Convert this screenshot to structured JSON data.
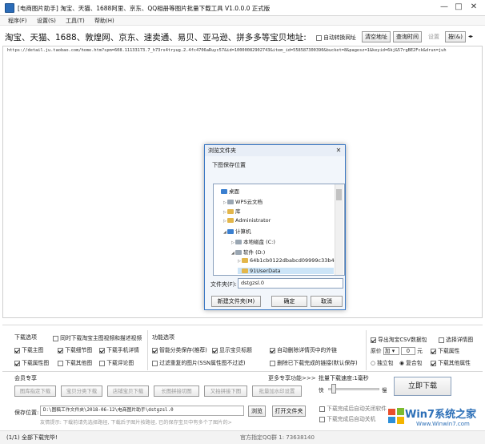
{
  "app": {
    "title": "[电商图片助手] 淘宝、天猫、1688阿里、京东、QQ相册等图片批量下载工具 V1.0.0.0 正式版",
    "window_controls": [
      "—",
      "□",
      "✕"
    ]
  },
  "menu": [
    "程序(F)",
    "设置(S)",
    "工具(T)",
    "帮助(H)"
  ],
  "url_row": {
    "label": "淘宝、天猫、1688、敦煌网、京东、速卖通、易贝、亚马逊、拼多多等宝贝地址:",
    "auto_check": "自动转换网址",
    "btn_clear": "清空地址",
    "btn_query": "查询时间",
    "btn_settings": "设置",
    "btn_more": "按(&)"
  },
  "urls": {
    "line": "https://detail.ju.taobao.com/home.htm?spm=608.11133173.7_h73rs4tryug.2.4fc4706aRuyc57&id=10000082902743&item_id=558587300390&bucket=8&pagesz=1&keyid=6kj&57rgBE2Fck&drun=juh"
  },
  "dialog": {
    "title": "浏览文件夹",
    "close": "✕",
    "subtitle": "下图保存位置",
    "tree": [
      {
        "label": "桌面",
        "icon": "desktop-icon",
        "color": "#3a7fd0",
        "arrow": ""
      },
      {
        "label": "WPS云文档",
        "icon": "cloud-icon",
        "color": "#9aa6b2",
        "arrow": "▷"
      },
      {
        "label": "库",
        "icon": "library-icon",
        "color": "#e3b64a",
        "arrow": "▷"
      },
      {
        "label": "Administrator",
        "icon": "user-folder-icon",
        "color": "#e3b64a",
        "arrow": "▷"
      },
      {
        "label": "计算机",
        "icon": "computer-icon",
        "color": "#3a7fd0",
        "arrow": "◢"
      },
      {
        "label": "本地磁盘 (C:)",
        "icon": "drive-icon",
        "color": "#9aa6b2",
        "arrow": "▷"
      },
      {
        "label": "软件 (D:)",
        "icon": "drive-icon",
        "color": "#9aa6b2",
        "arrow": "◢"
      },
      {
        "label": "64b1cb0122dbabcd09999c33b40",
        "icon": "folder-icon",
        "color": "#e3b64a",
        "arrow": "▷"
      },
      {
        "label": "91UserData",
        "icon": "folder-icon",
        "color": "#e3b64a",
        "arrow": ""
      }
    ],
    "folder_label": "文件夹(F):",
    "folder_value": "dstgzsl.0",
    "btn_new": "新建文件夹(M)",
    "btn_ok": "确定",
    "btn_cancel": "取消"
  },
  "download_options": {
    "header": "下载选项",
    "items": [
      {
        "label": "同时下载淘宝主图视频和描述视频",
        "checked": false
      },
      {
        "label": "下载主图",
        "checked": true
      },
      {
        "label": "下载细节图",
        "checked": true
      },
      {
        "label": "下载手机详情",
        "checked": true
      },
      {
        "label": "下载属性图",
        "checked": true
      },
      {
        "label": "下载其他图",
        "checked": false
      },
      {
        "label": "下载评论图",
        "checked": false
      }
    ]
  },
  "function_options": {
    "header": "功能选项",
    "items": [
      {
        "label": "智能分类保存(推荐)",
        "checked": true
      },
      {
        "label": "显示宝贝标题",
        "checked": true
      },
      {
        "label": "自动删除详情页中的外链",
        "checked": true
      },
      {
        "label": "过滤重复的图片(SSN属性图不过滤)",
        "checked": false
      },
      {
        "label": "删除已下载完成的链接(默认保存)",
        "checked": false
      }
    ]
  },
  "right_options": {
    "export_csv": "导出淘宝CSV数据包",
    "pick_detail": "选择详情图",
    "price_label": "原价",
    "price_op": "加",
    "price_value": "0",
    "price_unit": "元",
    "download_attr": "下载属性",
    "standalone": "独立包",
    "combined": "复合包",
    "download_other": "下载其他属性"
  },
  "member": {
    "header": "会员专享",
    "more": "更多专享功能>>>",
    "buttons": [
      "图库指定下载",
      "宝贝分类下载",
      "店铺宝贝下载",
      "长图拼接切图",
      "又拍拼接下图",
      "批量加水印设置"
    ]
  },
  "speed": {
    "label": "批量下载速度:1毫秒",
    "slow": "快",
    "fast": "慢",
    "btn_start": "立即下载"
  },
  "save_path": {
    "label": "保存位置:",
    "value": "D:\\图稿工作文件夹\\2018-06-12\\电商图片助手\\dstgzsl.0",
    "btn_browse": "浏览",
    "btn_open": "打开文件夹",
    "tip": "友情提示: 下载前请先选择路径, 下载后子图片按路径, 已的保存宝贝中有多个了图片的>",
    "check_a": "下载完成后自动关闭软件",
    "check_b": "下载完成后自动关机"
  },
  "status": {
    "left": "(1/1) 全部下载完毕!",
    "mid": "官方指定QQ群 1: 73638140"
  },
  "watermark": {
    "brand": "Win7系统之家",
    "url": "Www.Winwin7.com"
  }
}
